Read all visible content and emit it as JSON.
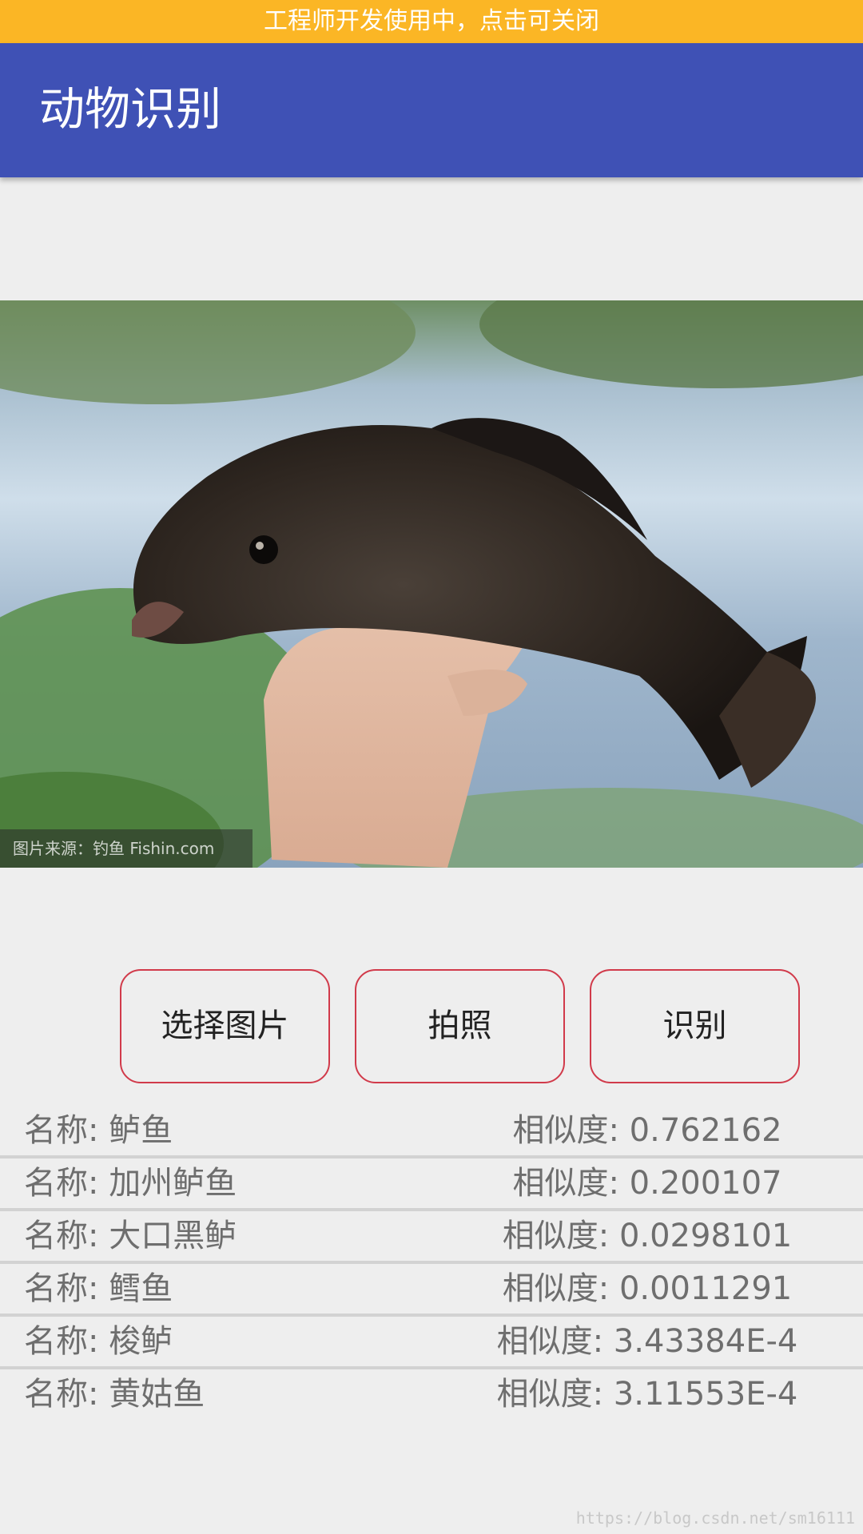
{
  "dev_banner": "工程师开发使用中，点击可关闭",
  "app_bar": {
    "title": "动物识别"
  },
  "photo": {
    "watermark": "图片来源：钓鱼 Fishin.com"
  },
  "buttons": {
    "choose": "选择图片",
    "camera": "拍照",
    "recognize": "识别"
  },
  "results": [
    {
      "name": "名称: 鲈鱼",
      "score": "相似度: 0.762162"
    },
    {
      "name": "名称: 加州鲈鱼",
      "score": "相似度: 0.200107"
    },
    {
      "name": "名称: 大口黑鲈",
      "score": "相似度: 0.0298101"
    },
    {
      "name": "名称: 鳕鱼",
      "score": "相似度: 0.0011291"
    },
    {
      "name": "名称: 梭鲈",
      "score": "相似度: 3.43384E-4"
    },
    {
      "name": "名称: 黄姑鱼",
      "score": "相似度: 3.11553E-4"
    }
  ],
  "footer_url": "https://blog.csdn.net/sm16111",
  "colors": {
    "app_bar": "#3f51b5",
    "dev_banner": "#fbb625",
    "button_border": "#d13a4a"
  }
}
